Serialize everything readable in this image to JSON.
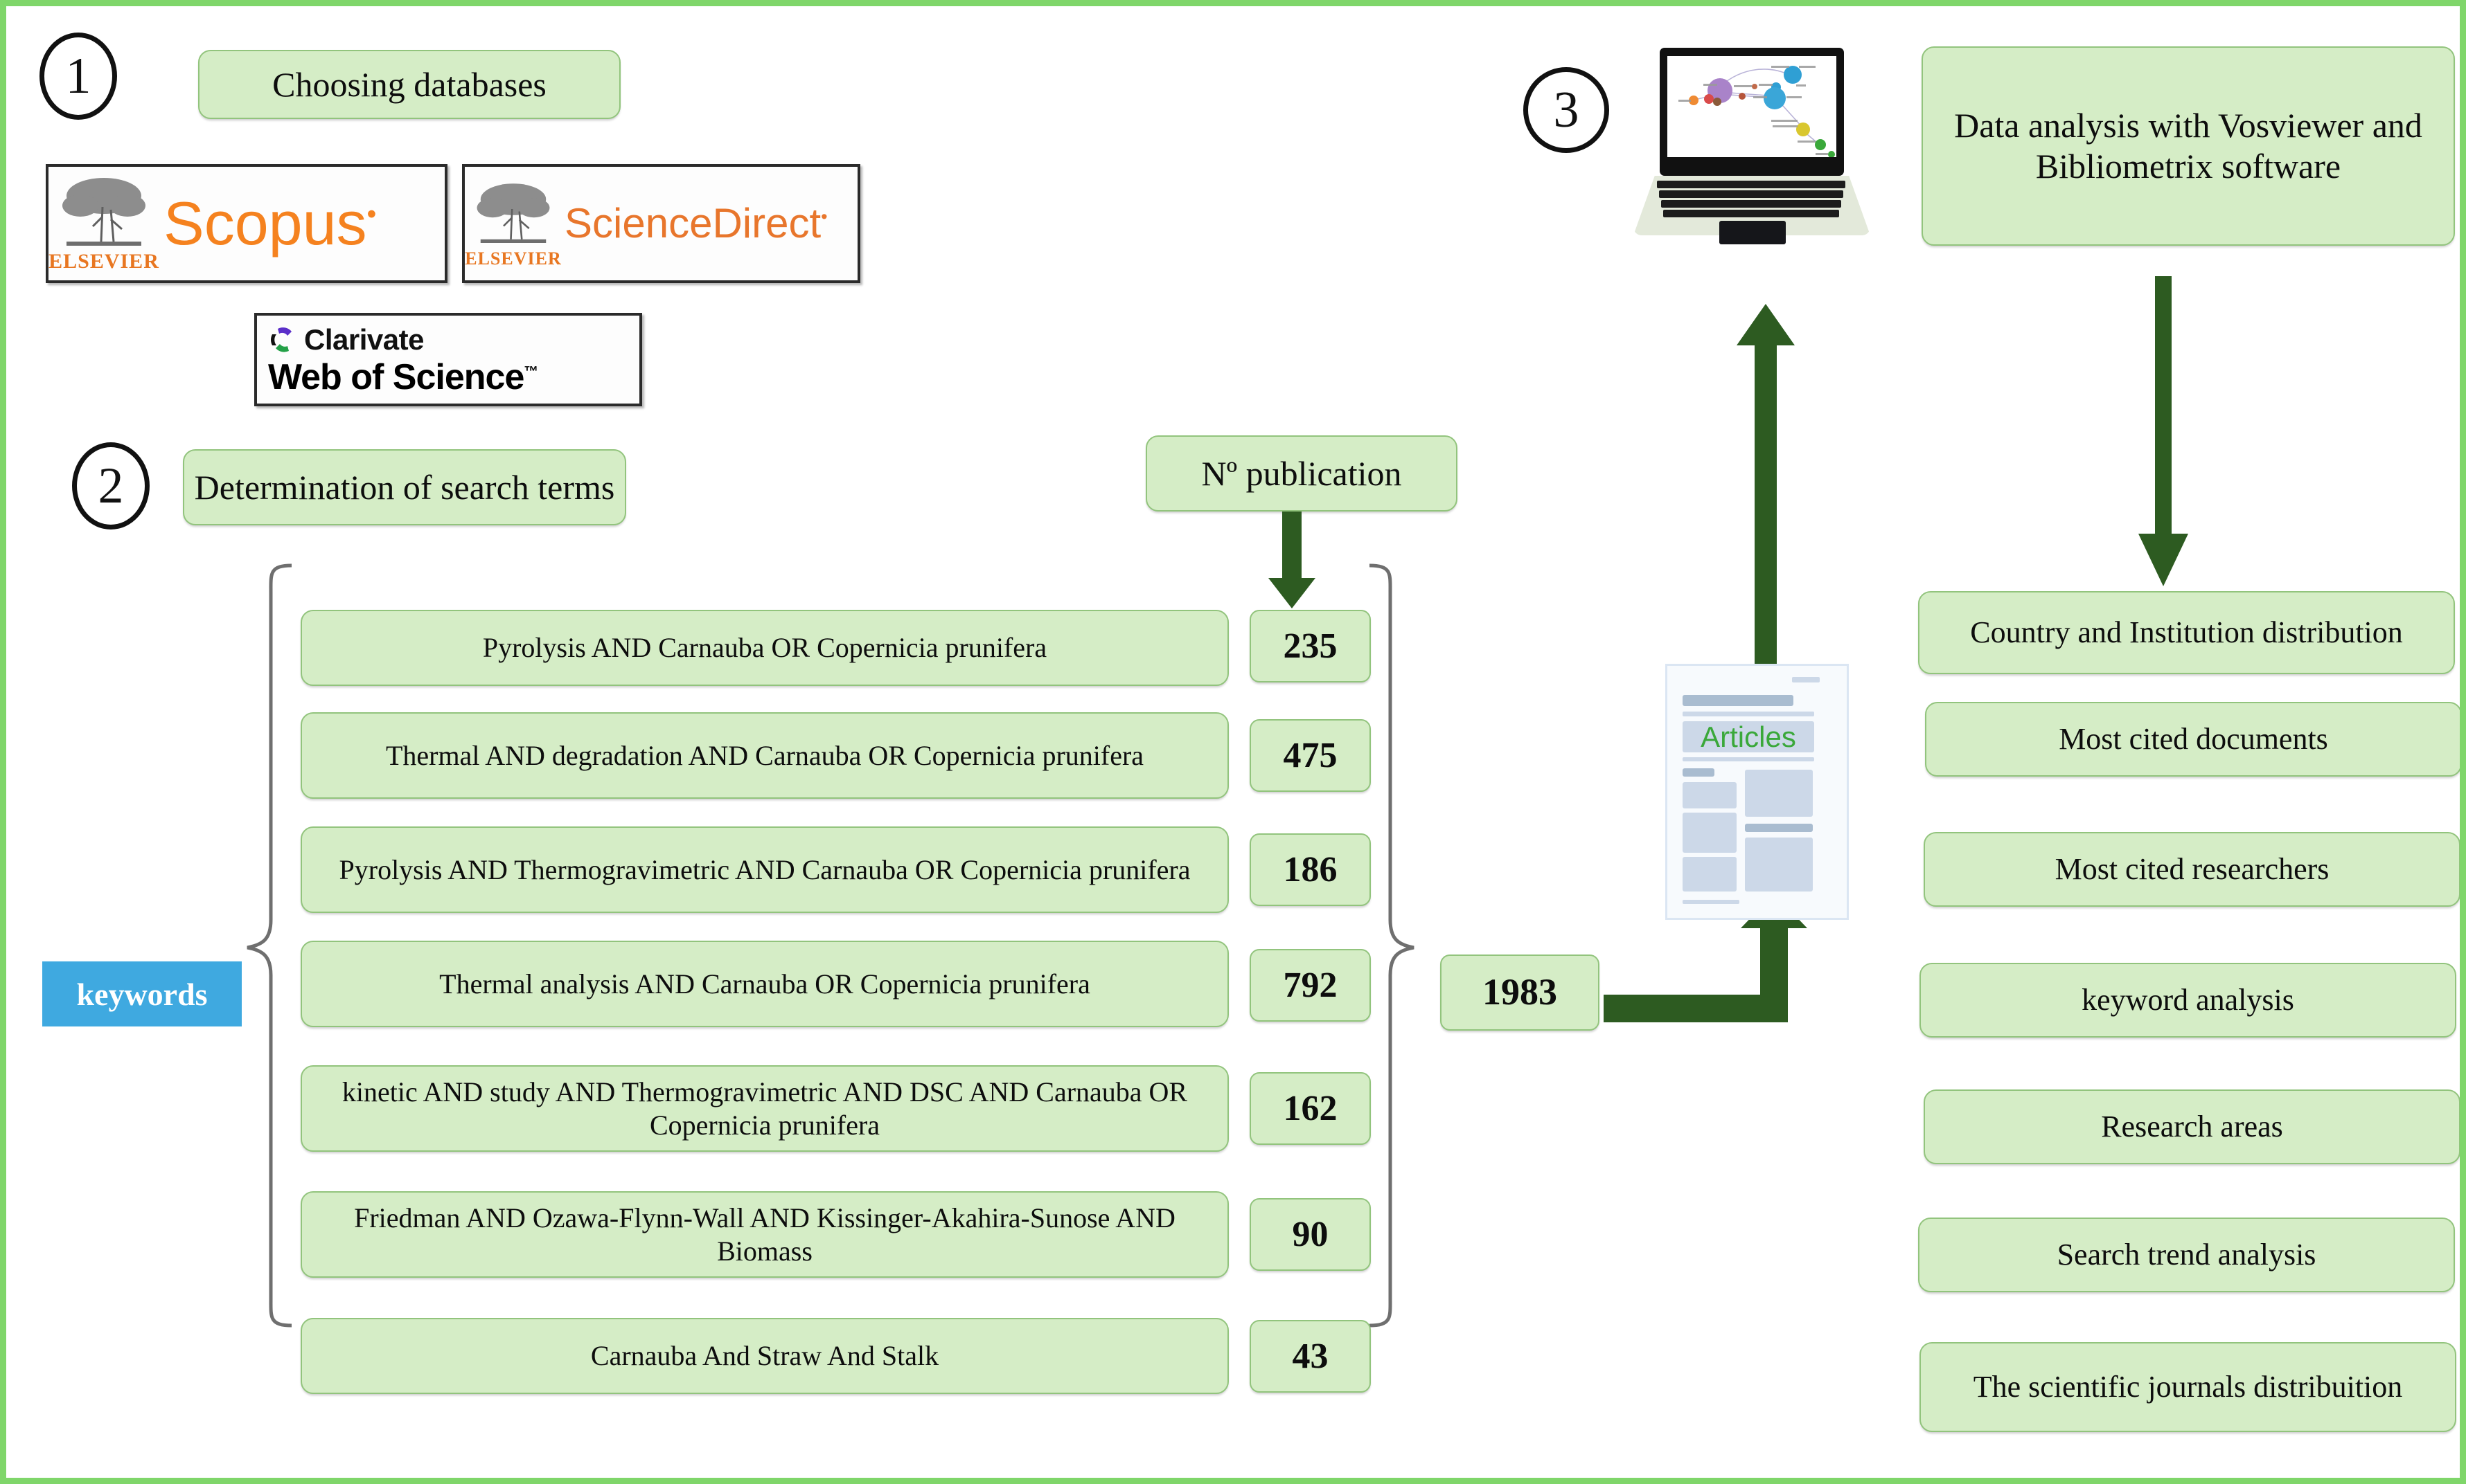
{
  "steps": [
    {
      "number": "1",
      "label": "Choosing  databases"
    },
    {
      "number": "2",
      "label": "Determination  of search  terms"
    },
    {
      "number": "3",
      "label": ""
    }
  ],
  "databases": [
    {
      "publisher": "ELSEVIER",
      "brand": "Scopus",
      "mark": "•"
    },
    {
      "publisher": "ELSEVIER",
      "brand": "ScienceDirect",
      "mark": "•"
    },
    {
      "publisher": "Clarivate",
      "brand": "Web of Science",
      "mark": "™"
    }
  ],
  "keywords_tag": "keywords",
  "publication_header": "Nº publication",
  "search_terms": [
    {
      "query": "Pyrolysis AND Carnauba OR Copernicia prunifera",
      "count": "235"
    },
    {
      "query": "Thermal AND degradation AND Carnauba OR Copernicia prunifera",
      "count": "475"
    },
    {
      "query": "Pyrolysis AND Thermogravimetric  AND Carnauba OR Copernicia prunifera",
      "count": "186"
    },
    {
      "query": "Thermal analysis AND Carnauba OR Copernicia prunifera",
      "count": "792"
    },
    {
      "query": "kinetic AND study AND Thermogravimetric  AND DSC AND Carnauba OR Copernicia prunifera",
      "count": "162"
    },
    {
      "query": "Friedman AND Ozawa-Flynn-Wall AND Kissinger-Akahira-Sunose AND Biomass",
      "count": "90"
    },
    {
      "query": "Carnauba And Straw And Stalk",
      "count": "43"
    }
  ],
  "total": "1983",
  "articles_label": "Articles",
  "analysis_box": "Data analysis  with Vosviewer and Bibliometrix software",
  "outputs": [
    "Country and Institution distribution",
    "Most cited documents",
    "Most cited researchers",
    "keyword analysis",
    "Research areas",
    "Search trend analysis",
    "The scientific  journals distribuition"
  ],
  "colors": {
    "frame": "#7fd66a",
    "box_fill": "#d5edc6",
    "box_border": "#92c47d",
    "arrow": "#2d5b21",
    "keywords_tag": "#3fa9e0",
    "brand_orange": "#f5821f",
    "articles_green": "#3aa83a"
  }
}
